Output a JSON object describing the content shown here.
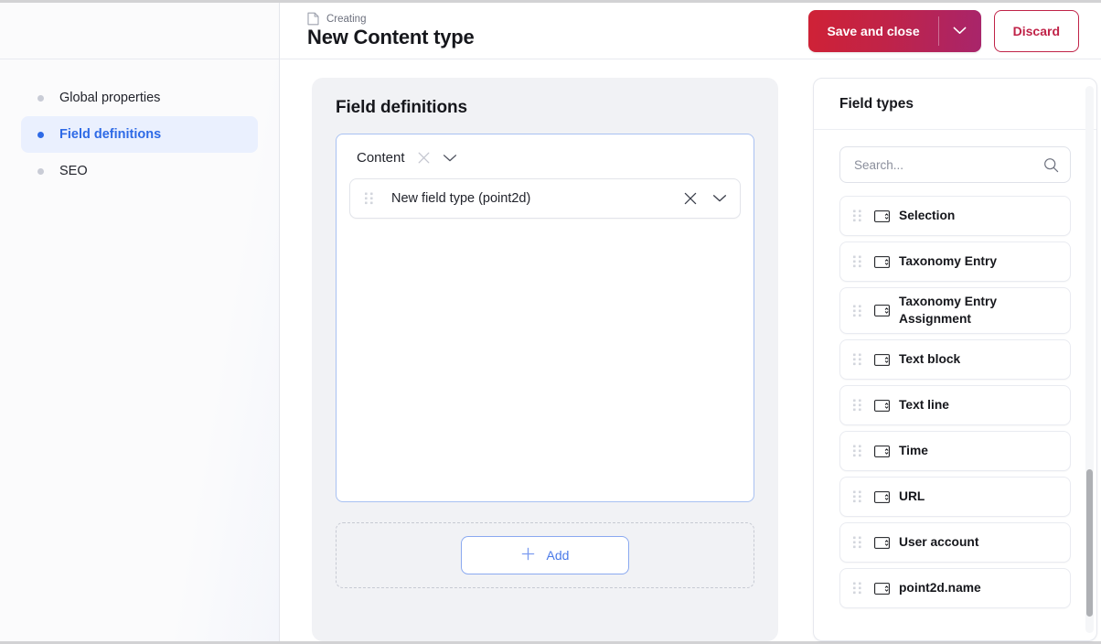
{
  "header": {
    "breadcrumb_icon": "document-icon",
    "breadcrumb": "Creating",
    "title": "New Content type",
    "save_label": "Save and close",
    "save_caret_icon": "chevron-down-icon",
    "discard_label": "Discard",
    "accent_red": "#c02348",
    "accent_magenta": "#a8256b"
  },
  "sidebar": {
    "items": [
      {
        "label": "Global properties",
        "active": false
      },
      {
        "label": "Field definitions",
        "active": true
      },
      {
        "label": "SEO",
        "active": false
      }
    ],
    "active_color": "#2e6ae6"
  },
  "field_definitions": {
    "title": "Field definitions",
    "group": {
      "label": "Content",
      "close_icon": "close-icon",
      "collapse_icon": "chevron-down-icon"
    },
    "fields": [
      {
        "label": "New field type (point2d)",
        "grip_icon": "drag-handle-icon",
        "close_icon": "close-icon",
        "collapse_icon": "chevron-down-icon"
      }
    ],
    "add_label": "Add",
    "add_icon": "plus-icon"
  },
  "field_types": {
    "title": "Field types",
    "search": {
      "value": "",
      "placeholder": "Search...",
      "icon": "search-icon"
    },
    "items": [
      {
        "label": "Selection"
      },
      {
        "label": "Taxonomy Entry"
      },
      {
        "label": "Taxonomy Entry Assignment"
      },
      {
        "label": "Text block"
      },
      {
        "label": "Text line"
      },
      {
        "label": "Time"
      },
      {
        "label": "URL"
      },
      {
        "label": "User account"
      },
      {
        "label": "point2d.name"
      }
    ],
    "item_grip_icon": "drag-handle-icon",
    "item_type_icon": "select-field-icon",
    "scrollbar": {
      "thumb_top_pct": 70,
      "thumb_height_pct": 27
    }
  }
}
